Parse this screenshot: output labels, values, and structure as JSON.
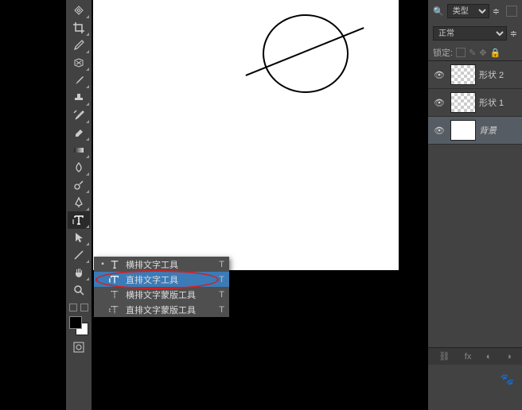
{
  "tools": {
    "type_flyout": {
      "items": [
        {
          "label": "横排文字工具",
          "shortcut": "T",
          "active": false,
          "marked": true
        },
        {
          "label": "直排文字工具",
          "shortcut": "T",
          "active": true,
          "marked": false
        },
        {
          "label": "横排文字蒙版工具",
          "shortcut": "T",
          "active": false,
          "marked": false
        },
        {
          "label": "直排文字蒙版工具",
          "shortcut": "T",
          "active": false,
          "marked": false
        }
      ]
    }
  },
  "layers_panel": {
    "filter_label": "类型",
    "blend_mode": "正常",
    "lock_label": "锁定:",
    "layers": [
      {
        "name": "形状 2",
        "visible": true,
        "selected": false
      },
      {
        "name": "形状 1",
        "visible": true,
        "selected": false
      },
      {
        "name": "背景",
        "visible": true,
        "selected": true,
        "italic": true
      }
    ]
  }
}
